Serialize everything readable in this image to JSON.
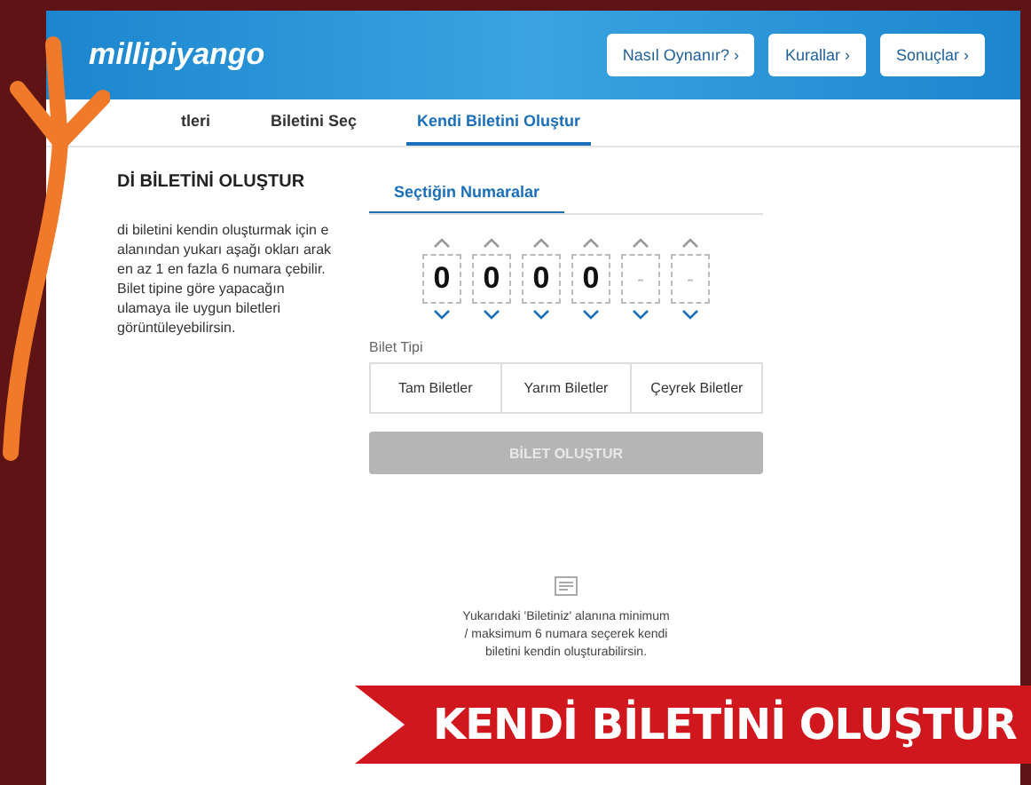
{
  "header": {
    "logo": "millipiyango",
    "buttons": [
      "Nasıl Oynanır? ›",
      "Kurallar ›",
      "Sonuçlar ›"
    ]
  },
  "tabs": [
    {
      "label": "tleri",
      "selected": false
    },
    {
      "label": "Biletini Seç",
      "selected": false
    },
    {
      "label": "Kendi Biletini Oluştur",
      "selected": true
    }
  ],
  "intro": {
    "title": "Dİ BİLETİNİ OLUŞTUR",
    "text": "di biletini kendin oluşturmak için e alanından yukarı aşağı okları arak en az 1 en fazla 6 numara çebilir. Bilet tipine göre yapacağın ulamaya ile uygun biletleri görüntüleyebilirsin."
  },
  "picker": {
    "tab": "Seçtiğin Numaralar",
    "digits": [
      "0",
      "0",
      "0",
      "0",
      "-",
      "-"
    ],
    "ticket_type_label": "Bilet Tipi",
    "ticket_types": [
      {
        "label": "Tam Biletler",
        "selected": false
      },
      {
        "label": "Yarım Biletler",
        "selected": false
      },
      {
        "label": "Çeyrek Biletler",
        "selected": false
      }
    ],
    "create_button": {
      "label": "BİLET OLUŞTUR",
      "disabled": true
    }
  },
  "info": "Yukarıdaki 'Biletiniz' alanına minimum / maksimum 6 numara seçerek kendi biletini kendin oluşturabilirsin.",
  "banner": "KENDİ BİLETİNİ OLUŞTUR"
}
